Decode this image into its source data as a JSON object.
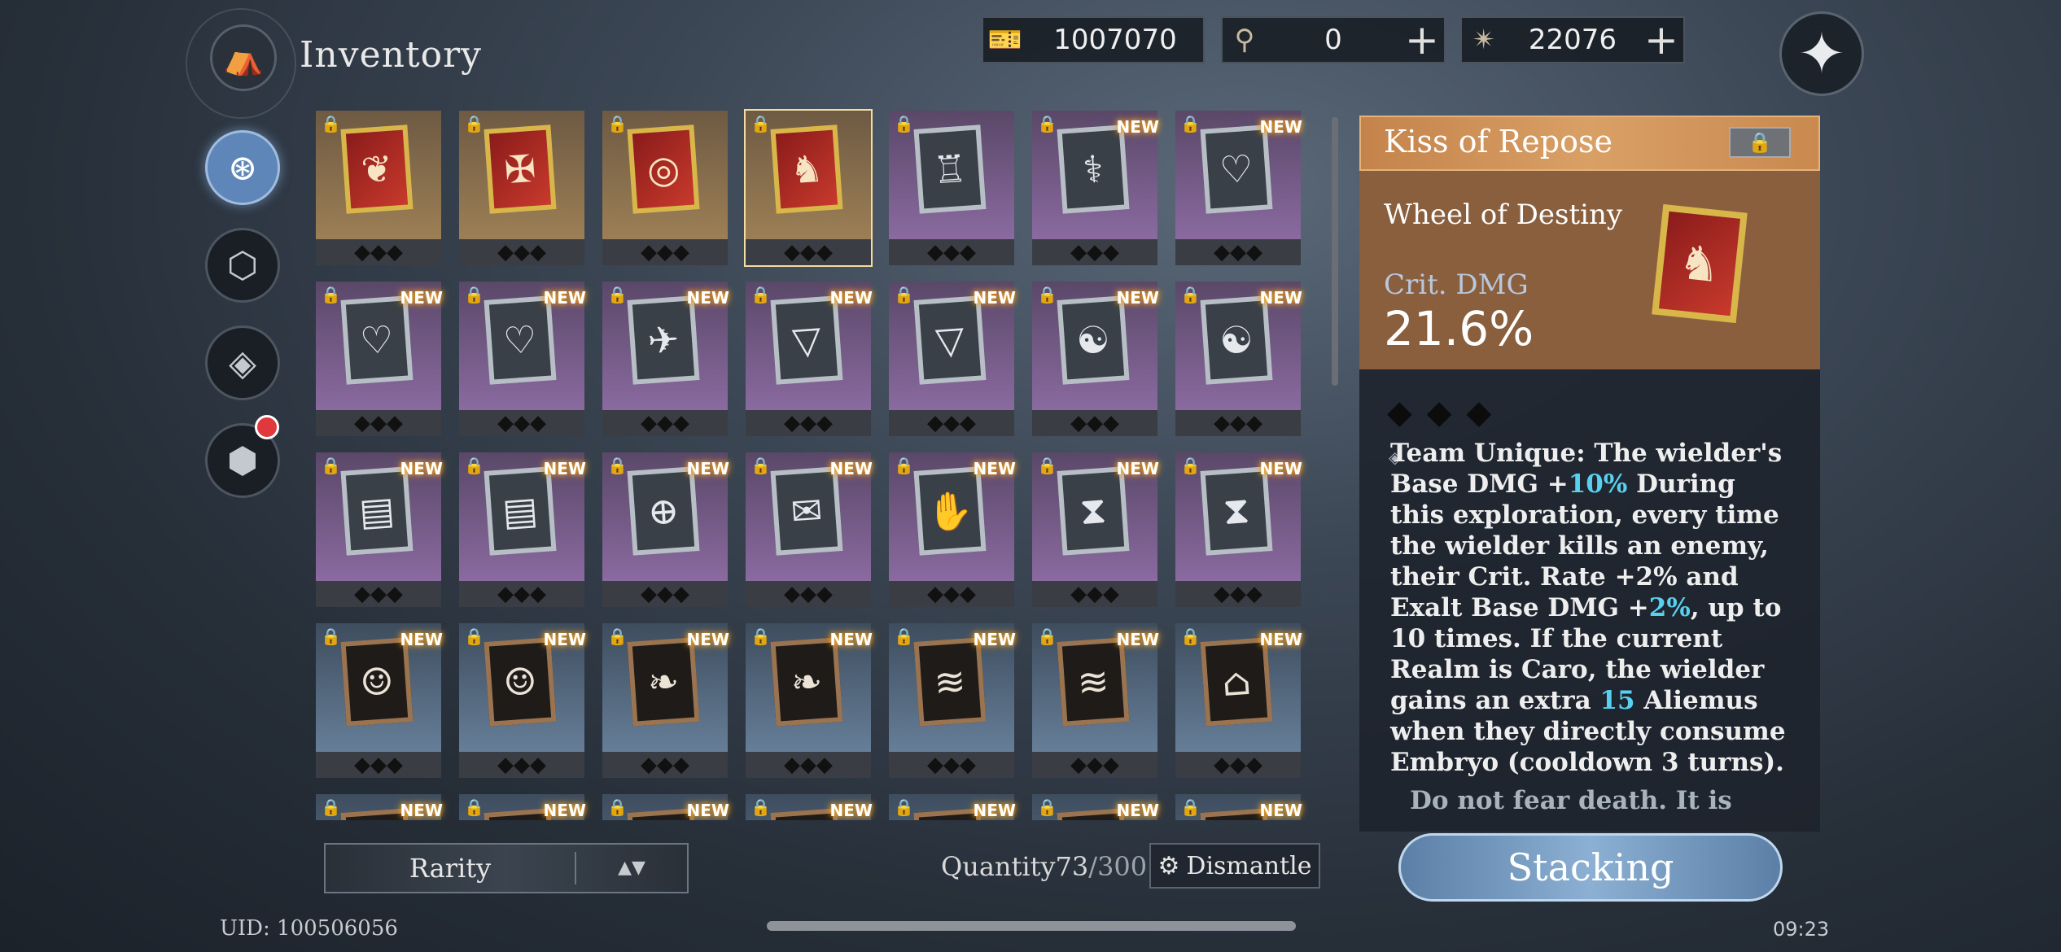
{
  "header": {
    "title": "Inventory",
    "logo_icon": "backpack-icon",
    "currencies": [
      {
        "icon": "ticket-icon",
        "value": "1007070",
        "has_plus": false
      },
      {
        "icon": "orb-staff-icon",
        "value": "0",
        "has_plus": true
      },
      {
        "icon": "star-crystal-icon",
        "value": "22076",
        "has_plus": true
      }
    ],
    "plus_label": "+",
    "compass_icon": "compass-star-icon"
  },
  "sidebar": {
    "items": [
      {
        "icon": "compass-circle-icon",
        "active": true
      },
      {
        "icon": "hexagon-icon",
        "active": false
      },
      {
        "icon": "diamond-target-icon",
        "active": false
      },
      {
        "icon": "cube-icon",
        "active": false,
        "badge": true
      }
    ]
  },
  "grid": {
    "lock_glyph": "🔒",
    "new_label": "NEW",
    "pips": "◆◆◆",
    "items": [
      {
        "rarity": "gold",
        "frame": "gold",
        "glyph": "❦",
        "is_new": false,
        "selected": false
      },
      {
        "rarity": "gold",
        "frame": "gold",
        "glyph": "✠",
        "is_new": false,
        "selected": false
      },
      {
        "rarity": "gold",
        "frame": "gold",
        "glyph": "◎",
        "is_new": false,
        "selected": false
      },
      {
        "rarity": "gold",
        "frame": "gold",
        "glyph": "♞",
        "is_new": false,
        "selected": true
      },
      {
        "rarity": "purple",
        "frame": "silver",
        "glyph": "♖",
        "is_new": false,
        "selected": false
      },
      {
        "rarity": "purple",
        "frame": "silver",
        "glyph": "⚕",
        "is_new": true,
        "selected": false
      },
      {
        "rarity": "purple",
        "frame": "silver",
        "glyph": "♡",
        "is_new": true,
        "selected": false
      },
      {
        "rarity": "purple",
        "frame": "silver",
        "glyph": "♡",
        "is_new": true,
        "selected": false
      },
      {
        "rarity": "purple",
        "frame": "silver",
        "glyph": "♡",
        "is_new": true,
        "selected": false
      },
      {
        "rarity": "purple",
        "frame": "silver",
        "glyph": "✈",
        "is_new": true,
        "selected": false
      },
      {
        "rarity": "purple",
        "frame": "silver",
        "glyph": "▽",
        "is_new": true,
        "selected": false
      },
      {
        "rarity": "purple",
        "frame": "silver",
        "glyph": "▽",
        "is_new": true,
        "selected": false
      },
      {
        "rarity": "purple",
        "frame": "silver",
        "glyph": "☯",
        "is_new": true,
        "selected": false
      },
      {
        "rarity": "purple",
        "frame": "silver",
        "glyph": "☯",
        "is_new": true,
        "selected": false
      },
      {
        "rarity": "purple",
        "frame": "silver",
        "glyph": "▤",
        "is_new": true,
        "selected": false
      },
      {
        "rarity": "purple",
        "frame": "silver",
        "glyph": "▤",
        "is_new": true,
        "selected": false
      },
      {
        "rarity": "purple",
        "frame": "silver",
        "glyph": "⊕",
        "is_new": true,
        "selected": false
      },
      {
        "rarity": "purple",
        "frame": "silver",
        "glyph": "✉",
        "is_new": true,
        "selected": false
      },
      {
        "rarity": "purple",
        "frame": "silver",
        "glyph": "✋",
        "is_new": true,
        "selected": false
      },
      {
        "rarity": "purple",
        "frame": "silver",
        "glyph": "⧗",
        "is_new": true,
        "selected": false
      },
      {
        "rarity": "purple",
        "frame": "silver",
        "glyph": "⧗",
        "is_new": true,
        "selected": false
      },
      {
        "rarity": "blue",
        "frame": "wood",
        "glyph": "☺",
        "is_new": true,
        "selected": false
      },
      {
        "rarity": "blue",
        "frame": "wood",
        "glyph": "☺",
        "is_new": true,
        "selected": false
      },
      {
        "rarity": "blue",
        "frame": "wood",
        "glyph": "❧",
        "is_new": true,
        "selected": false
      },
      {
        "rarity": "blue",
        "frame": "wood",
        "glyph": "❧",
        "is_new": true,
        "selected": false
      },
      {
        "rarity": "blue",
        "frame": "wood",
        "glyph": "≋",
        "is_new": true,
        "selected": false
      },
      {
        "rarity": "blue",
        "frame": "wood",
        "glyph": "≋",
        "is_new": true,
        "selected": false
      },
      {
        "rarity": "blue",
        "frame": "wood",
        "glyph": "⌂",
        "is_new": true,
        "selected": false
      },
      {
        "rarity": "blue",
        "frame": "wood",
        "glyph": "",
        "is_new": true,
        "selected": false
      },
      {
        "rarity": "blue",
        "frame": "wood",
        "glyph": "",
        "is_new": true,
        "selected": false
      },
      {
        "rarity": "blue",
        "frame": "wood",
        "glyph": "",
        "is_new": true,
        "selected": false
      },
      {
        "rarity": "blue",
        "frame": "wood",
        "glyph": "",
        "is_new": true,
        "selected": false
      },
      {
        "rarity": "blue",
        "frame": "wood",
        "glyph": "",
        "is_new": true,
        "selected": false
      },
      {
        "rarity": "blue",
        "frame": "wood",
        "glyph": "",
        "is_new": true,
        "selected": false
      },
      {
        "rarity": "blue",
        "frame": "wood",
        "glyph": "",
        "is_new": true,
        "selected": false
      }
    ]
  },
  "footer": {
    "sort_label": "Rarity",
    "sort_arrows": "▲▼",
    "quantity_label": "Quantity",
    "quantity_current": "73",
    "quantity_max": "/300",
    "dismantle_label": "Dismantle",
    "uid": "UID: 100506056",
    "clock": "09:23"
  },
  "detail": {
    "name": "Kiss of Repose",
    "lock_glyph": "🔒",
    "set_name": "Wheel of Destiny",
    "stat_label": "Crit. DMG",
    "stat_value": "21.6%",
    "pips": "◆◆◆",
    "bullet": "◈",
    "desc_parts": [
      "Team Unique: The wielder's Base DMG +",
      "10%",
      " During this exploration, every time the wielder kills an enemy, their Crit. Rate +2% and Exalt Base DMG +",
      "2%",
      ", up to 10 times. If the current Realm is Caro, the wielder gains an extra ",
      "15",
      " Aliemus when they directly consume Embryo (cooldown 3 turns)."
    ],
    "flavor": "Do not fear death. It is",
    "stacking_label": "Stacking"
  },
  "colors": {
    "accent_blue": "#58d0f0",
    "gold_rarity": "#c9a76a",
    "purple_rarity": "#c498e0",
    "blue_rarity": "#9cc2e4",
    "badge_red": "#e0383d"
  }
}
